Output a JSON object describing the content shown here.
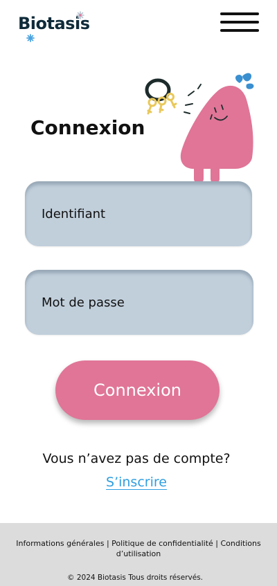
{
  "app": {
    "logo_text": "Biotasis"
  },
  "header": {
    "menu_icon": "hamburger-menu-icon"
  },
  "login": {
    "title": "Connexion",
    "username_placeholder": "Identifiant",
    "password_placeholder": "Mot de passe",
    "submit_label": "Connexion",
    "no_account_text": "Vous n’avez pas de compte?",
    "signup_label": "S’inscrire"
  },
  "footer": {
    "link_general": "Informations générales",
    "link_privacy": "Politique de confidentialité",
    "link_terms": "Conditions d’utilisation",
    "separator": " | ",
    "copyright": "© 2024 Biotasis   Tous droits réservés."
  },
  "colors": {
    "primary_pink": "#e07597",
    "field_background": "#c1cfdb",
    "link_blue": "#2f9ee0",
    "footer_background": "#dcdcdc",
    "logo_dark": "#0f2b3a",
    "leaf_blue": "#3a8fd0",
    "key_yellow": "#e9c85a"
  },
  "icons": {
    "mascot": "mascot-with-keys-illustration",
    "logo_flowers": "flower-icon"
  }
}
